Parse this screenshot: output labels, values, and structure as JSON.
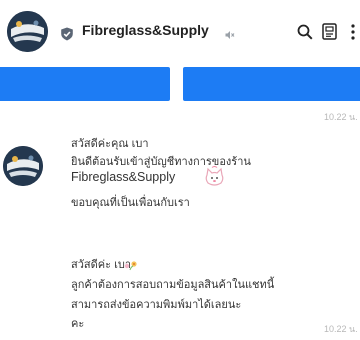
{
  "header": {
    "title": "Fibreglass&Supply",
    "icons": [
      "verified-badge-icon",
      "mute-icon",
      "search-icon",
      "notes-icon",
      "more-vertical-icon"
    ]
  },
  "timestamps": [
    "10.22 น.",
    "10.22 น."
  ],
  "messages": [
    {
      "lines": [
        "สวัสดีค่ะคุณ เบา",
        "ยินดีต้อนรับเข้าสู่บัญชีทางการของร้าน",
        "Fibreglass&Supply",
        "ขอบคุณที่เป็นเพื่อนกับเรา"
      ]
    },
    {
      "lines": [
        "สวัสดีค่ะ เบา",
        "ลูกค้าต้องการสอบถามข้อมูลสินค้าในแชทนี้",
        "สามารถส่งข้อความพิมพ์มาได้เลยนะ",
        "คะ"
      ]
    }
  ],
  "colors": {
    "accent": "#1d7cf4",
    "timestamp": "#b8b8b8"
  }
}
